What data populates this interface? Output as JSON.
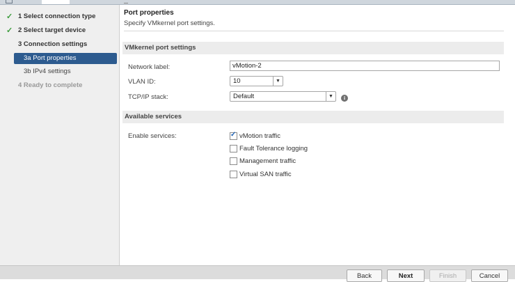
{
  "sidebar": {
    "steps": [
      {
        "label": "1  Select connection type",
        "state": "completed"
      },
      {
        "label": "2  Select target device",
        "state": "completed"
      },
      {
        "label": "3  Connection settings",
        "state": "current-parent"
      },
      {
        "label": "3a  Port properties",
        "state": "active"
      },
      {
        "label": "3b  IPv4 settings",
        "state": "pending"
      },
      {
        "label": "4  Ready to complete",
        "state": "disabled"
      }
    ]
  },
  "header": {
    "title": "Port properties",
    "subtitle": "Specify VMkernel port settings."
  },
  "port_settings": {
    "section_title": "VMkernel port settings",
    "network_label": {
      "label": "Network label:",
      "value": "vMotion-2"
    },
    "vlan_id": {
      "label": "VLAN ID:",
      "value": "10"
    },
    "tcpip_stack": {
      "label": "TCP/IP stack:",
      "value": "Default"
    }
  },
  "services": {
    "section_title": "Available services",
    "label": "Enable services:",
    "items": [
      {
        "label": "vMotion traffic",
        "checked": true
      },
      {
        "label": "Fault Tolerance logging",
        "checked": false
      },
      {
        "label": "Management traffic",
        "checked": false
      },
      {
        "label": "Virtual SAN traffic",
        "checked": false
      }
    ]
  },
  "footer": {
    "back": "Back",
    "next": "Next",
    "finish": "Finish",
    "cancel": "Cancel"
  },
  "colors": {
    "active_step": "#2d5b8f",
    "check_green": "#3c9b3c",
    "sidebar_bg": "#efefef"
  }
}
